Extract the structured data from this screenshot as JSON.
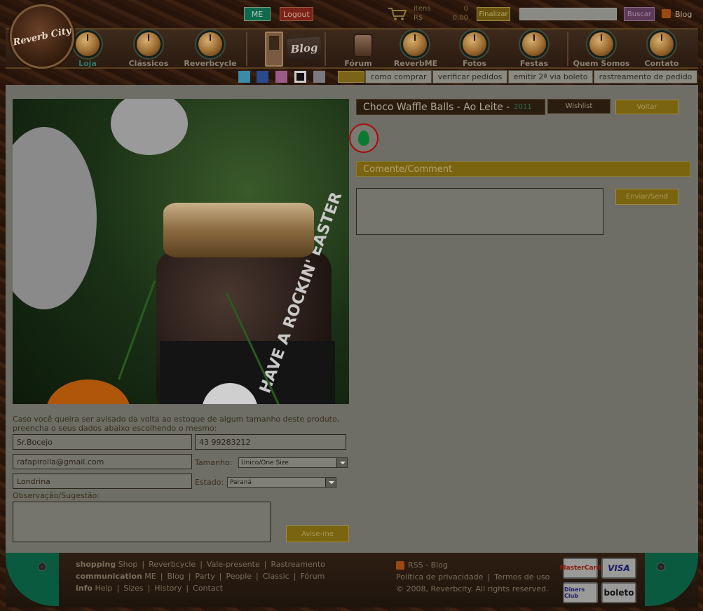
{
  "topbar": {
    "me_label": "ME",
    "logout_label": "Logout",
    "cart_items_label": "itens",
    "cart_currency_label": "R$",
    "cart_items_count": "0",
    "cart_total": "0,00",
    "finalizar_label": "Finalizar",
    "search_value": "",
    "buscar_label": "Buscar",
    "blog_label": "Blog"
  },
  "logo_text": "Reverb City",
  "nav": {
    "items": [
      {
        "label": "Loja",
        "active": true
      },
      {
        "label": "Clássicos"
      },
      {
        "label": "Reverbcycle"
      },
      {
        "label": "Blog"
      },
      {
        "label": "Fórum"
      },
      {
        "label": "ReverbME"
      },
      {
        "label": "Fotos"
      },
      {
        "label": "Festas"
      },
      {
        "label": "Quem Somos"
      },
      {
        "label": "Contato"
      }
    ]
  },
  "social_icons": [
    "twitter-icon",
    "facebook-icon",
    "instagram-icon",
    "square-icon",
    "flickr-icon"
  ],
  "quick_links": [
    "como comprar",
    "verificar pedidos",
    "emitir 2ª via boleto",
    "rastreamento de pedido"
  ],
  "product": {
    "title": "Choco Waffle Balls - Ao Leite -",
    "year": "2011",
    "wishlist_label": "Wishlist",
    "voltar_label": "Voltar",
    "photo_text": "HAVE A ROCKIN' EASTER"
  },
  "comment": {
    "heading": "Comente/Comment",
    "value": "",
    "send_label": "Enviar/Send"
  },
  "notify_form": {
    "notice": "Caso você queira ser avisado da volta ao estoque de algum tamanho deste produto, preencha o seus dados abaixo escolhendo o mesmo:",
    "name_value": "Sr.Bocejo",
    "phone_value": "43 99283212",
    "email_value": "rafapirolla@gmail.com",
    "size_label": "Tamanho:",
    "size_value": "Unico/One Size",
    "city_value": "Londrina",
    "state_label": "Estado:",
    "state_value": "Paraná",
    "obs_label": "Observação/Sugestão:",
    "obs_value": "",
    "submit_label": "Avise-me"
  },
  "footer": {
    "shopping_label": "shopping",
    "shopping_links": [
      "Shop",
      "Reverbcycle",
      "Vale-presente",
      "Rastreamento"
    ],
    "communication_label": "communication",
    "communication_links": [
      "ME",
      "Blog",
      "Party",
      "People",
      "Classic",
      "Fórum"
    ],
    "info_label": "info",
    "info_links": [
      "Help",
      "Sizes",
      "History",
      "Contact"
    ],
    "rss_label": "RSS - Blog",
    "privacy_label": "Política de privacidade",
    "terms_label": "Termos de uso",
    "copyright": "© 2008, Reverbcity. All rights reserved.",
    "payment_cards": [
      "MasterCard",
      "VISA",
      "Diners Club",
      "boleto"
    ]
  },
  "colors": {
    "accent_gold": "#7a6410",
    "brand_green": "#0a5a40",
    "active_nav": "#2a7a6a",
    "panel_bg": "#6e6d66"
  }
}
